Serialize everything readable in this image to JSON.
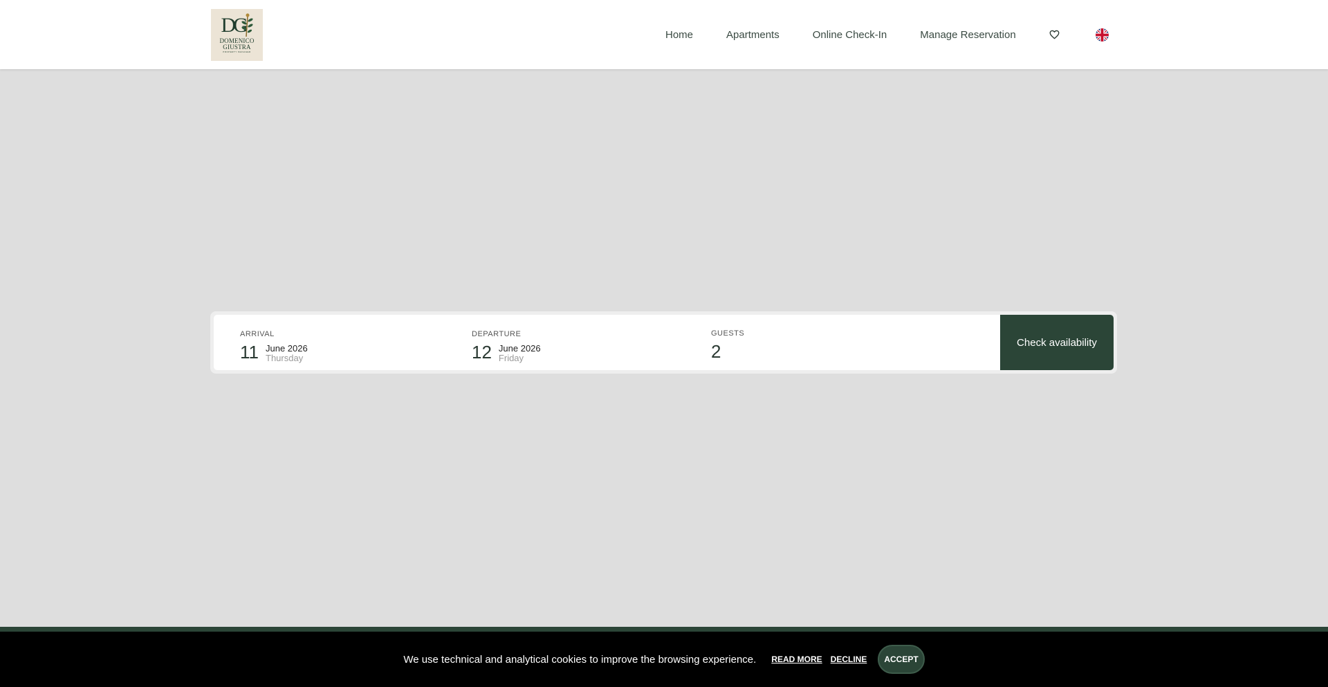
{
  "brand": {
    "logo_mark": "DG",
    "logo_name_line1": "DOMENICO",
    "logo_name_line2": "GIUSTRA",
    "logo_tagline": "property manager"
  },
  "nav": {
    "items": [
      {
        "label": "Home"
      },
      {
        "label": "Apartments"
      },
      {
        "label": "Online Check-In"
      },
      {
        "label": "Manage Reservation"
      }
    ],
    "wishlist_icon": "heart-icon",
    "language_icon": "uk-flag-icon"
  },
  "search": {
    "arrival": {
      "label": "ARRIVAL",
      "day": "11",
      "month": "June 2026",
      "weekday": "Thursday"
    },
    "departure": {
      "label": "DEPARTURE",
      "day": "12",
      "month": "June 2026",
      "weekday": "Friday"
    },
    "guests": {
      "label": "GUESTS",
      "value": "2"
    },
    "button_label": "Check availability"
  },
  "cookie": {
    "message": "We use technical and analytical cookies to improve the browsing experience.",
    "read_more": "READ MORE",
    "decline": "DECLINE",
    "accept": "ACCEPT"
  },
  "colors": {
    "primary": "#2b4537",
    "background": "#dedede",
    "logo_bg": "#ece4d6"
  }
}
